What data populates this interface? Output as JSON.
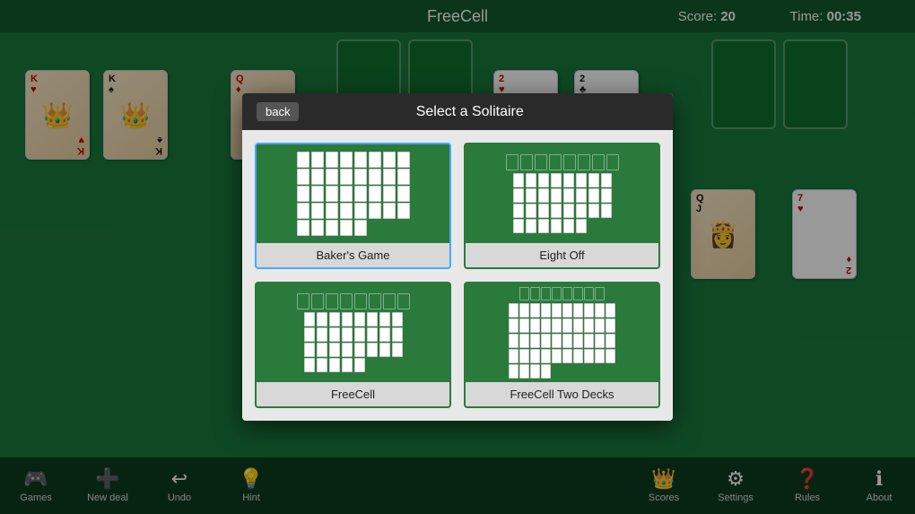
{
  "header": {
    "title": "FreeCell",
    "score_label": "Score:",
    "score_value": "20",
    "time_label": "Time:",
    "time_value": "00:35"
  },
  "toolbar_left": [
    {
      "id": "games",
      "icon": "🎮",
      "label": "Games"
    },
    {
      "id": "new_deal",
      "icon": "➕",
      "label": "New deal"
    },
    {
      "id": "undo",
      "icon": "↩",
      "label": "Undo"
    },
    {
      "id": "hint",
      "icon": "💡",
      "label": "Hint"
    }
  ],
  "toolbar_right": [
    {
      "id": "scores",
      "icon": "👑",
      "label": "Scores"
    },
    {
      "id": "settings",
      "icon": "⚙",
      "label": "Settings"
    },
    {
      "id": "rules",
      "icon": "❓",
      "label": "Rules"
    },
    {
      "id": "about",
      "icon": "ℹ",
      "label": "About"
    }
  ],
  "modal": {
    "back_label": "back",
    "title": "Select a Solitaire",
    "games": [
      {
        "id": "bakers_game",
        "label": "Baker's Game"
      },
      {
        "id": "eight_off",
        "label": "Eight Off"
      },
      {
        "id": "freecell",
        "label": "FreeCell"
      },
      {
        "id": "freecell_two_decks",
        "label": "FreeCell Two Decks"
      }
    ]
  }
}
